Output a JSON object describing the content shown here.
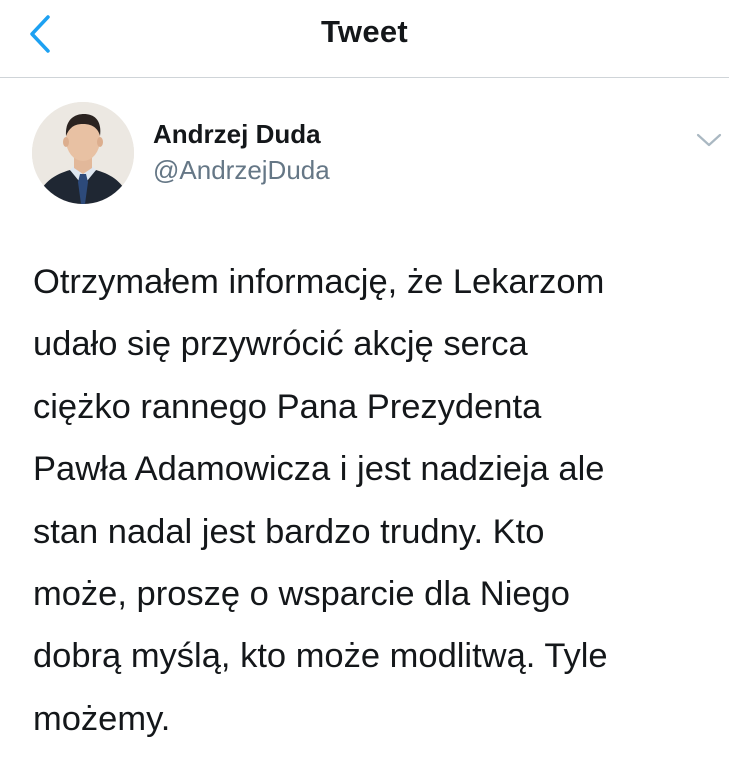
{
  "nav": {
    "title": "Tweet"
  },
  "tweet": {
    "author": {
      "name": "Andrzej Duda",
      "handle": "@AndrzejDuda"
    },
    "text_lines": [
      "Otrzymałem informację, że Lekarzom",
      "udało się przywrócić akcję serca",
      "ciężko rannego Pana Prezydenta",
      "Pawła Adamowicza i jest nadzieja ale",
      "stan nadal jest bardzo trudny. Kto",
      "może, proszę o wsparcie dla Niego",
      "dobrą myślą, kto może modlitwą. Tyle",
      "możemy."
    ]
  },
  "icons": {
    "back": "chevron-left-icon",
    "more": "chevron-down-icon"
  },
  "colors": {
    "accent": "#1da1f2",
    "text": "#14171a",
    "secondary": "#657786",
    "divider": "#cfd4d8"
  }
}
